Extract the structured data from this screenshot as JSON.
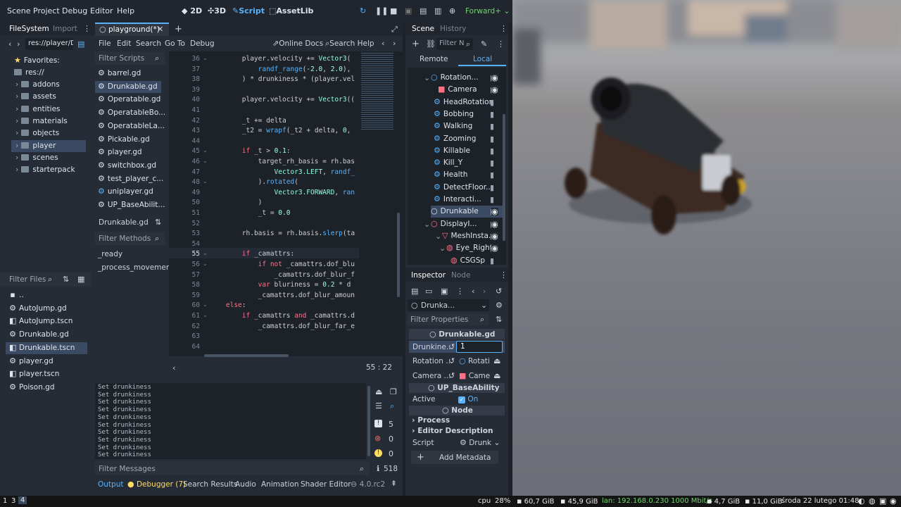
{
  "menu": {
    "scene": "Scene",
    "project": "Project",
    "debug": "Debug",
    "editor": "Editor",
    "help": "Help"
  },
  "workspaces": {
    "w2d": "2D",
    "w3d": "3D",
    "script": "Script",
    "assetlib": "AssetLib"
  },
  "renderer": "Forward+",
  "filesystem": {
    "tab": "FileSystem",
    "tab2": "Import",
    "path": "res://player/D",
    "favorites": "Favorites:",
    "root": "res://",
    "folders": [
      "addons",
      "assets",
      "entities",
      "materials",
      "objects",
      "player",
      "scenes",
      "starterpack"
    ],
    "filter": "Filter Files",
    "files": [
      "..",
      "AutoJump.gd",
      "AutoJump.tscn",
      "Drunkable.gd",
      "Drunkable.tscn",
      "player.gd",
      "player.tscn",
      "Poison.gd"
    ]
  },
  "script_editor": {
    "tab": "playground(*)",
    "menu": [
      "File",
      "Edit",
      "Search",
      "Go To",
      "Debug"
    ],
    "online_docs": "Online Docs",
    "search_help": "Search Help",
    "filter_scripts": "Filter Scripts",
    "scripts": [
      "barrel.gd",
      "Drunkable.gd",
      "Operatable.gd",
      "OperatableBo...",
      "OperatableLa...",
      "Pickable.gd",
      "player.gd",
      "switchbox.gd",
      "test_player_c...",
      "uniplayer.gd",
      "UP_BaseAbilit..."
    ],
    "current_script": "Drunkable.gd",
    "filter_methods": "Filter Methods",
    "methods": [
      "_ready",
      "_process_movement"
    ],
    "cursor_pos": "55 :   22"
  },
  "code_lines": [
    {
      "n": "36",
      "t": "        player.velocity += Vector3("
    },
    {
      "n": "37",
      "t": "            randf_range(-2.0, 2.0),"
    },
    {
      "n": "38",
      "t": "        ) * drunkiness * (player.vel"
    },
    {
      "n": "39",
      "t": ""
    },
    {
      "n": "40",
      "t": "        player.velocity += Vector3(("
    },
    {
      "n": "41",
      "t": ""
    },
    {
      "n": "42",
      "t": "        _t += delta"
    },
    {
      "n": "43",
      "t": "        _t2 = wrapf(_t2 + delta, 0,"
    },
    {
      "n": "44",
      "t": ""
    },
    {
      "n": "45",
      "t": "        if _t > 0.1:"
    },
    {
      "n": "46",
      "t": "            target_rh_basis = rh.bas"
    },
    {
      "n": "47",
      "t": "                Vector3.LEFT, randf_"
    },
    {
      "n": "48",
      "t": "            ).rotated("
    },
    {
      "n": "49",
      "t": "                Vector3.FORWARD, ran"
    },
    {
      "n": "50",
      "t": "            )"
    },
    {
      "n": "51",
      "t": "            _t = 0.0"
    },
    {
      "n": "52",
      "t": ""
    },
    {
      "n": "53",
      "t": "        rh.basis = rh.basis.slerp(ta"
    },
    {
      "n": "54",
      "t": ""
    },
    {
      "n": "55",
      "t": "        if _camattrs:"
    },
    {
      "n": "56",
      "t": "            if not _camattrs.dof_blu"
    },
    {
      "n": "57",
      "t": "                _camattrs.dof_blur_f"
    },
    {
      "n": "58",
      "t": "            var bluriness = 0.2 * d"
    },
    {
      "n": "59",
      "t": "            _camattrs.dof_blur_amoun"
    },
    {
      "n": "60",
      "t": "    else:"
    },
    {
      "n": "61",
      "t": "        if _camattrs and _camattrs.d"
    },
    {
      "n": "62",
      "t": "            _camattrs.dof_blur_far_e"
    },
    {
      "n": "63",
      "t": ""
    },
    {
      "n": "64",
      "t": ""
    }
  ],
  "output": {
    "lines": [
      "Set drunkiness",
      "Set drunkiness",
      "Set drunkiness",
      "Set drunkiness",
      "Set drunkiness",
      "Set drunkiness",
      "Set drunkiness",
      "Set drunkiness",
      "Set drunkiness",
      "Set drunkiness"
    ],
    "warnings": "5",
    "errors": "0",
    "alerts": "0",
    "messages": "518",
    "filter": "Filter Messages"
  },
  "bottom_tabs": {
    "output": "Output",
    "debugger": "Debugger (7)",
    "search": "Search Results",
    "audio": "Audio",
    "animation": "Animation",
    "shader": "Shader Editor",
    "version": "4.0.rc2"
  },
  "scene_dock": {
    "tab": "Scene",
    "tab2": "History",
    "filter": "Filter N",
    "remote": "Remote",
    "local": "Local",
    "nodes": [
      "Rotation...",
      "Camera",
      "HeadRotation",
      "Bobbing",
      "Walking",
      "Zooming",
      "Killable",
      "Kill_Y",
      "Health",
      "DetectFloor...",
      "Interacti...",
      "Drunkable",
      "DisplayI...",
      "MeshInsta...",
      "Eye_Right",
      "CSGSp"
    ]
  },
  "inspector": {
    "tab": "Inspector",
    "tab2": "Node",
    "object": "Drunka...",
    "filter": "Filter Properties",
    "script_name": "Drunkable.gd",
    "drunk_label": "Drunkine...",
    "drunk_value": "1",
    "rotation_label": "Rotation ...",
    "rotation_value": "Rotati",
    "camera_label": "Camera ...",
    "camera_value": "Came",
    "base_ability": "UP_BaseAbility",
    "active_label": "Active",
    "active_value": "On",
    "node": "Node",
    "process": "Process",
    "editor_desc": "Editor Description",
    "script_label": "Script",
    "script_value": "Drunk",
    "add_metadata": "Add Metadata"
  },
  "taskbar": {
    "ws1": "1",
    "ws3": "3",
    "ws4": "4",
    "cpu_label": "cpu",
    "cpu": "28%",
    "disk1": "60,7 GiB",
    "disk2": "45,9 GiB",
    "lan": "lan: 192.168.0.230 1000 Mbit/s",
    "mem": "4,7 GiB",
    "swap": "11,0 GiB",
    "datetime": "środa 22 lutego 01:48"
  },
  "colors": {
    "accent": "#57b3ff",
    "bg": "#262c35",
    "warn": "#ffdd65",
    "err": "#ff5f5f"
  }
}
